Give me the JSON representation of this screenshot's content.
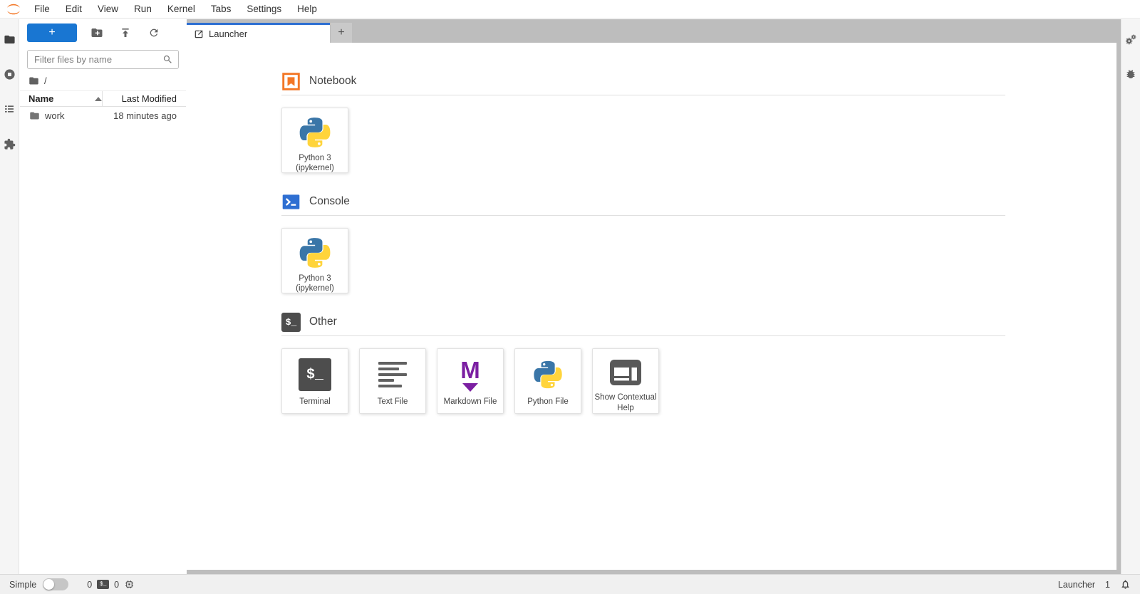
{
  "colors": {
    "accent_blue": "#1976d2",
    "jupyter_orange": "#f37726",
    "markdown_purple": "#7b1fa2",
    "python_blue": "#3a76a8",
    "python_yellow": "#ffd43b",
    "terminal_dark": "#4d4d4d"
  },
  "menubar": {
    "items": [
      "File",
      "Edit",
      "View",
      "Run",
      "Kernel",
      "Tabs",
      "Settings",
      "Help"
    ]
  },
  "left_activity": {
    "items": [
      {
        "icon": "folder-icon",
        "title": "File Browser"
      },
      {
        "icon": "running-sessions-icon",
        "title": "Running Terminals and Kernels"
      },
      {
        "icon": "table-of-contents-icon",
        "title": "Table of Contents"
      },
      {
        "icon": "extensions-icon",
        "title": "Extension Manager"
      }
    ]
  },
  "right_activity": {
    "items": [
      {
        "icon": "property-inspector-icon",
        "title": "Property Inspector"
      },
      {
        "icon": "debugger-icon",
        "title": "Debugger"
      }
    ]
  },
  "filebrowser": {
    "new_launcher_button": "+",
    "filter": {
      "placeholder": "Filter files by name"
    },
    "breadcrumb": "/",
    "table": {
      "columns": {
        "name": "Name",
        "modified": "Last Modified"
      },
      "rows": [
        {
          "name": "work",
          "modified": "18 minutes ago"
        }
      ]
    }
  },
  "tabbar": {
    "tabs": [
      {
        "label": "Launcher",
        "active": true
      }
    ],
    "new_tab": "+"
  },
  "launcher": {
    "sections": [
      {
        "title": "Notebook",
        "icon": "notebook-icon",
        "cards": [
          {
            "label": "Python 3 (ipykernel)",
            "icon": "python-logo-icon"
          }
        ]
      },
      {
        "title": "Console",
        "icon": "console-icon",
        "cards": [
          {
            "label": "Python 3 (ipykernel)",
            "icon": "python-logo-icon"
          }
        ]
      },
      {
        "title": "Other",
        "icon": "terminal-prompt-icon",
        "prompt_glyph": "$_",
        "cards": [
          {
            "label": "Terminal",
            "icon": "terminal-icon",
            "glyph": "$_"
          },
          {
            "label": "Text File",
            "icon": "text-file-icon"
          },
          {
            "label": "Markdown File",
            "icon": "markdown-icon",
            "glyph": "M"
          },
          {
            "label": "Python File",
            "icon": "python-logo-icon"
          },
          {
            "label": "Show Contextual Help",
            "icon": "contextual-help-icon"
          }
        ]
      }
    ]
  },
  "statusbar": {
    "mode_label": "Simple",
    "terminals_count": "0",
    "kernels_count": "0",
    "current_activity": "Launcher",
    "notifications_count": "1"
  }
}
